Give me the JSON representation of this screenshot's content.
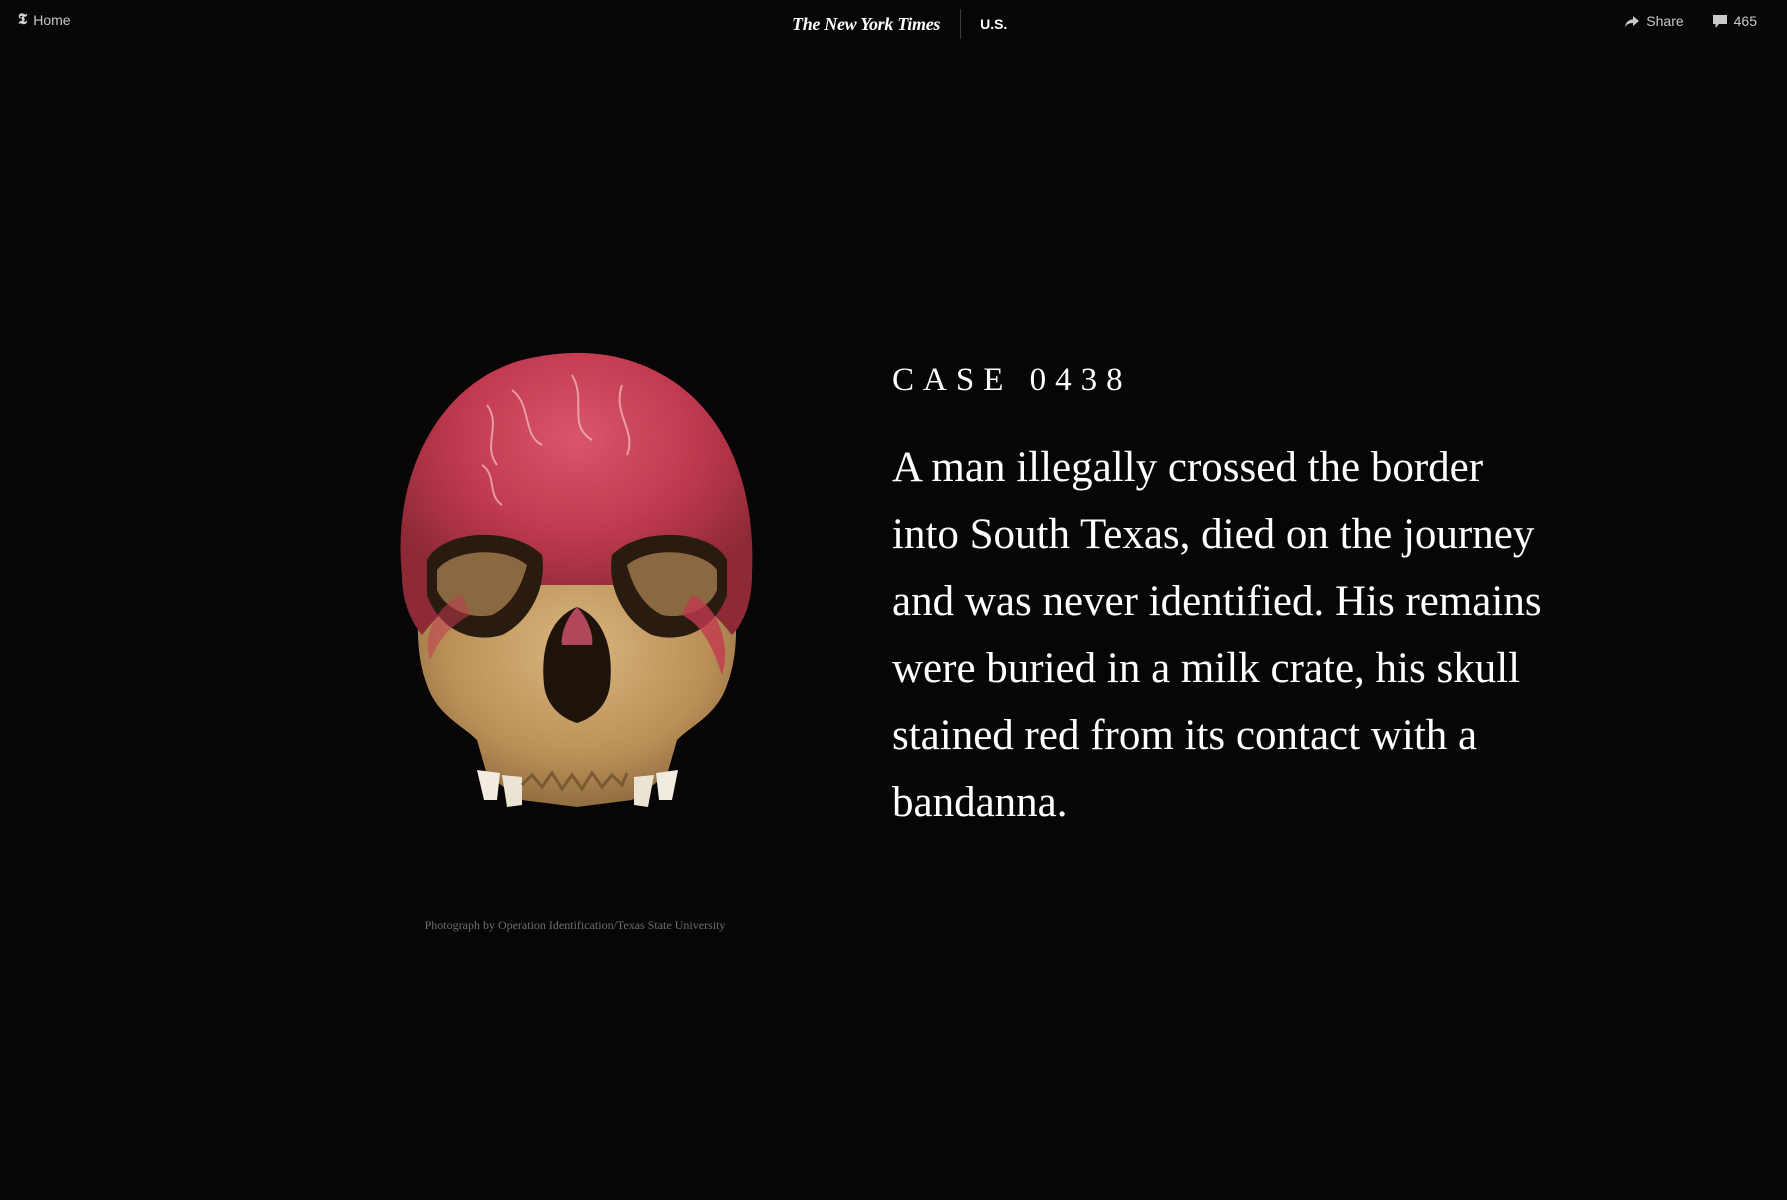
{
  "header": {
    "home_label": "Home",
    "home_icon": "nyt-t-icon",
    "logo_text": "The New York Times",
    "section": "U.S.",
    "share_label": "Share",
    "share_icon": "share-arrow-icon",
    "comments_count": "465",
    "comments_icon": "comment-bubble-icon"
  },
  "figure": {
    "credit": "Photograph by Operation Identification/Texas State University"
  },
  "story": {
    "case_label": "CASE 0438",
    "text": "A man illegally crossed the border into South Texas, died on the journey and was never identified. His remains were buried in a milk crate, his skull stained red from its contact with a bandanna."
  },
  "colors": {
    "background": "#070506",
    "text": "#ffffff",
    "muted": "#c9c9c9",
    "credit": "#6e6e6e",
    "bone": "#c9a26a",
    "stain": "#c8384c"
  }
}
